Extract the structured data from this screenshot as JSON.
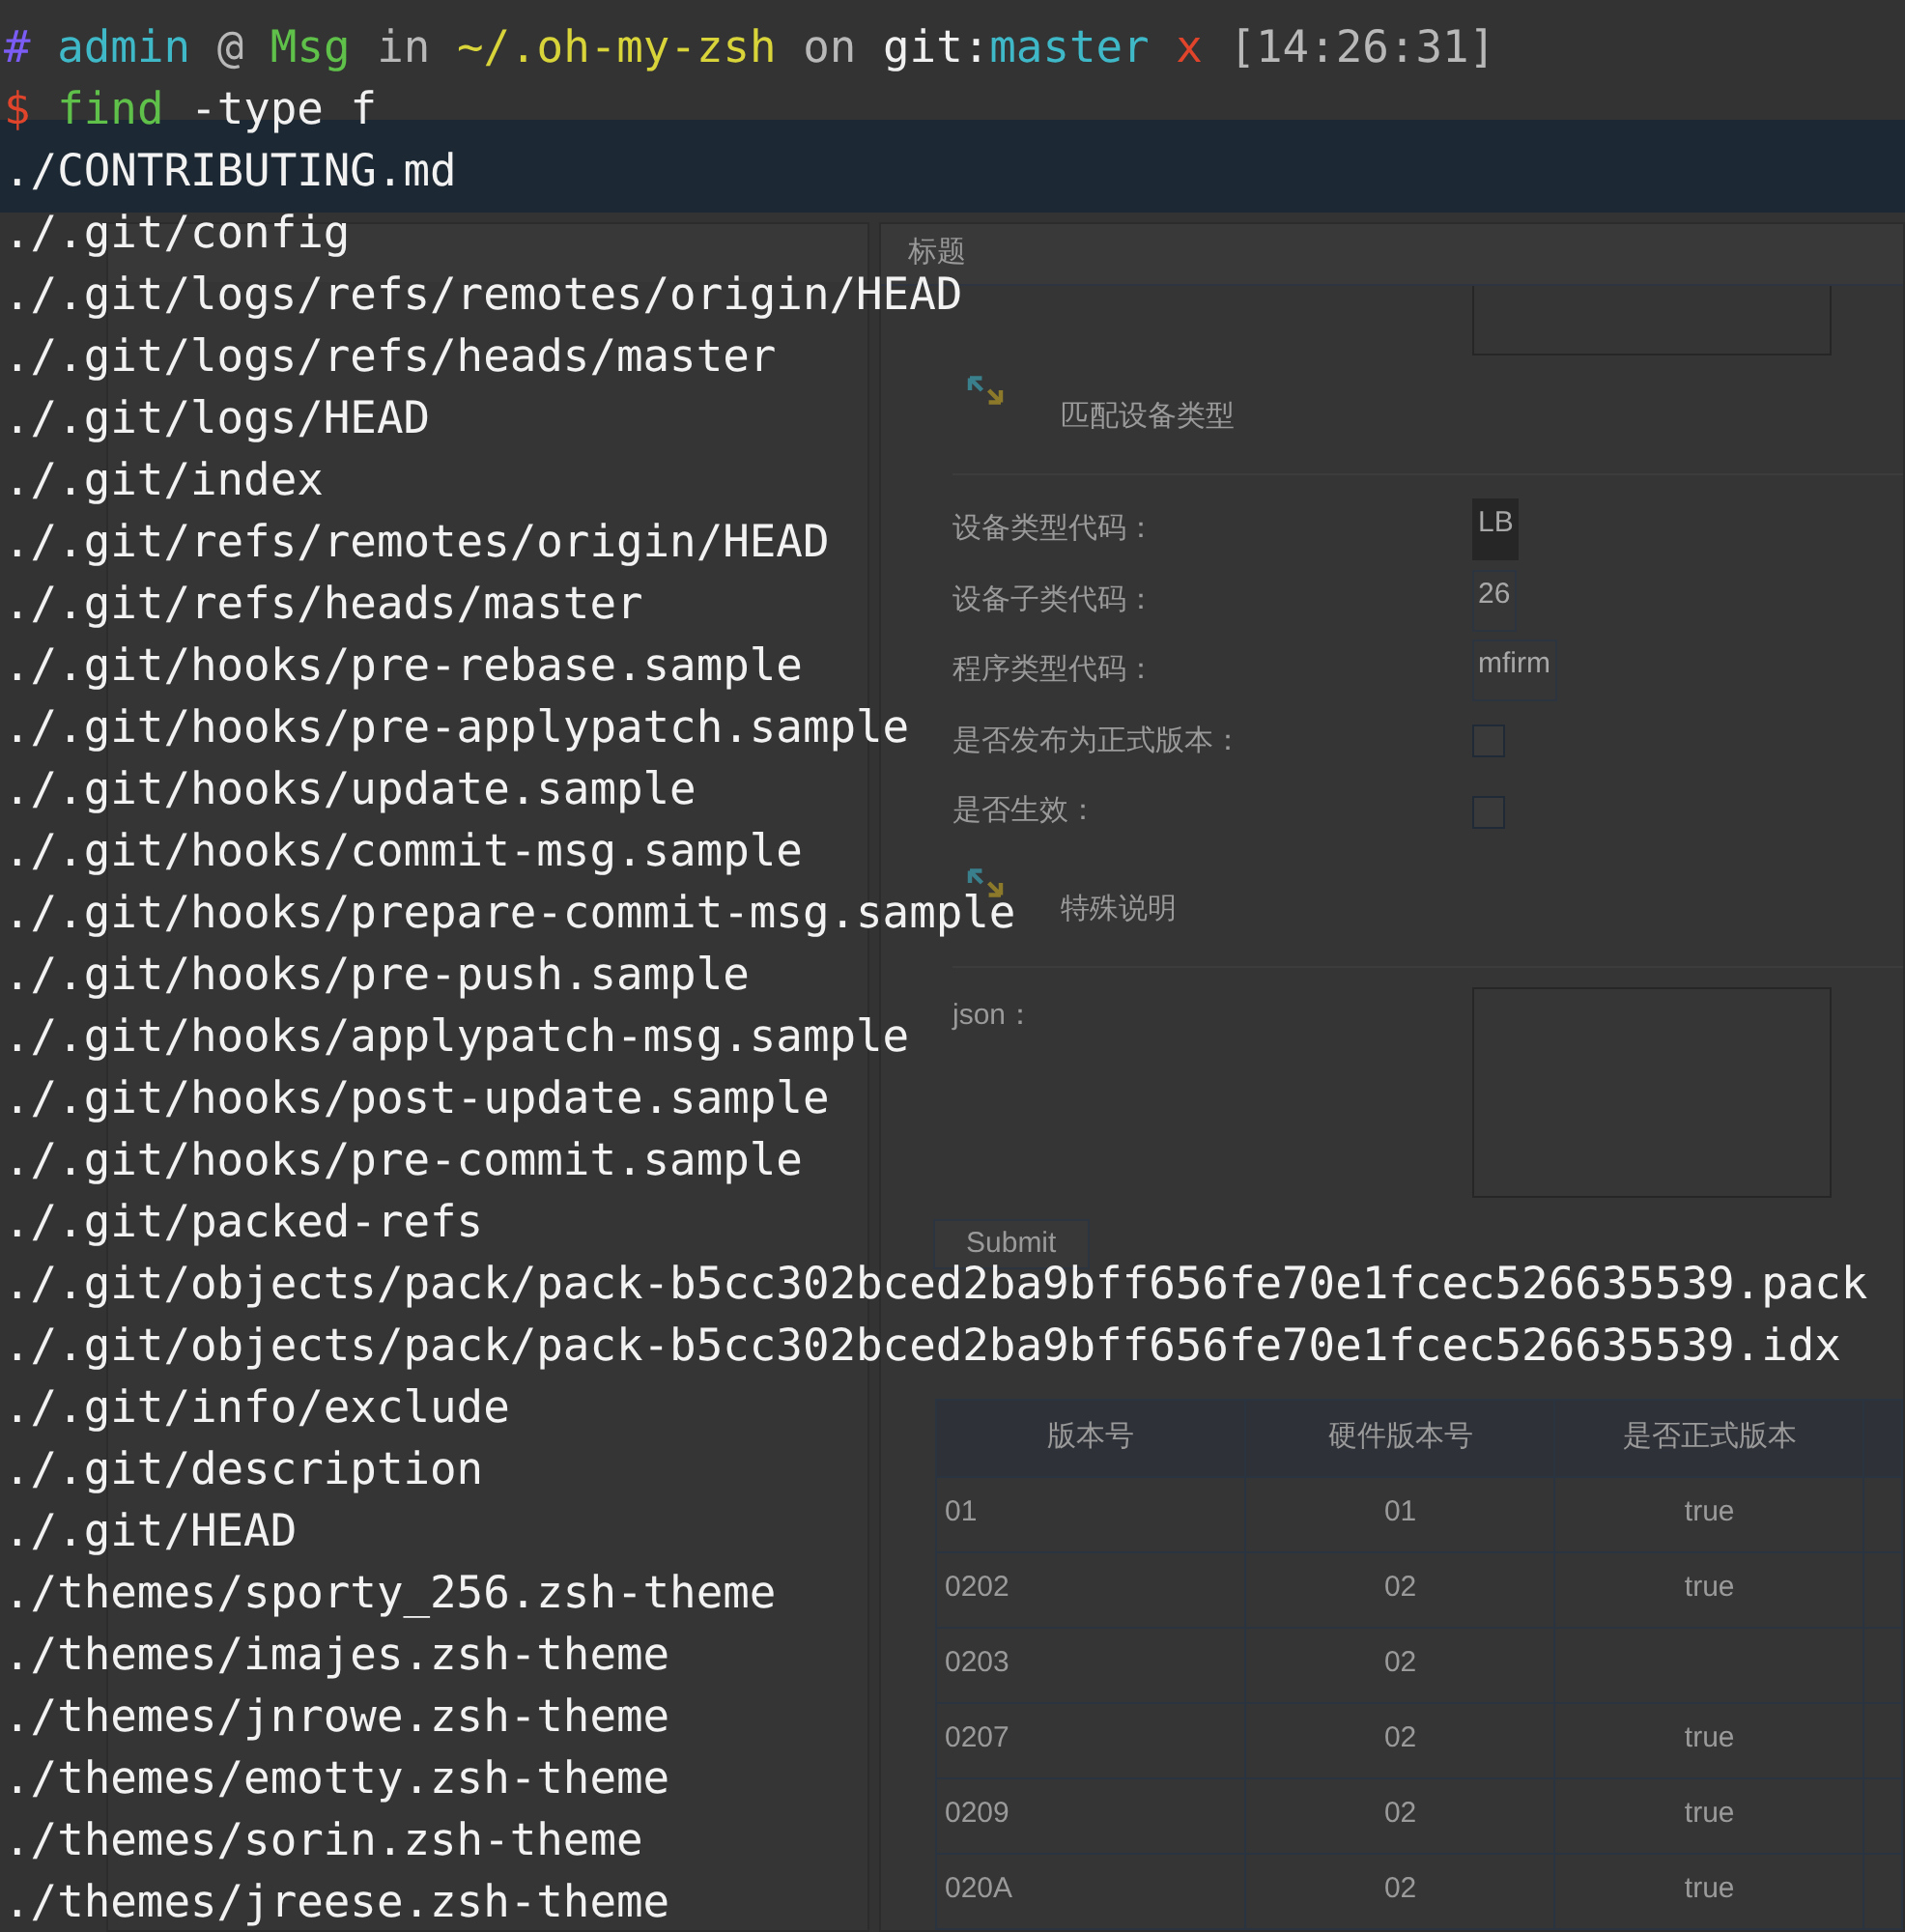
{
  "terminal": {
    "prompt": [
      {
        "text": "#",
        "color": "#7b5cf5"
      },
      {
        "text": "admin",
        "color": "#3fb8c8"
      },
      {
        "text": "@",
        "color": "#b8b8b8"
      },
      {
        "text": "Msg",
        "color": "#5fc04a"
      },
      {
        "text": "in",
        "color": "#b8b8b8"
      },
      {
        "text": "~/.oh-my-zsh",
        "color": "#d8d43a"
      },
      {
        "text": "on",
        "color": "#b8b8b8"
      },
      {
        "text": "git:",
        "color": "#f0f0f0"
      },
      {
        "text": "master",
        "color": "#3fb8c8",
        "join": true
      },
      {
        "text": "x",
        "color": "#e0452c"
      },
      {
        "text": "[14:26:31]",
        "color": "#b8b8b8"
      }
    ],
    "command": [
      {
        "text": "$",
        "color": "#e0452c"
      },
      {
        "text": "find",
        "color": "#5fc04a"
      },
      {
        "text": "-type f",
        "color": "#f0f0f0"
      }
    ],
    "output": [
      "./CONTRIBUTING.md",
      "./.git/config",
      "./.git/logs/refs/remotes/origin/HEAD",
      "./.git/logs/refs/heads/master",
      "./.git/logs/HEAD",
      "./.git/index",
      "./.git/refs/remotes/origin/HEAD",
      "./.git/refs/heads/master",
      "./.git/hooks/pre-rebase.sample",
      "./.git/hooks/pre-applypatch.sample",
      "./.git/hooks/update.sample",
      "./.git/hooks/commit-msg.sample",
      "./.git/hooks/prepare-commit-msg.sample",
      "./.git/hooks/pre-push.sample",
      "./.git/hooks/applypatch-msg.sample",
      "./.git/hooks/post-update.sample",
      "./.git/hooks/pre-commit.sample",
      "./.git/packed-refs",
      "./.git/objects/pack/pack-b5cc302bced2ba9bff656fe70e1fcec526635539.pack",
      "./.git/objects/pack/pack-b5cc302bced2ba9bff656fe70e1fcec526635539.idx",
      "./.git/info/exclude",
      "./.git/description",
      "./.git/HEAD",
      "./themes/sporty_256.zsh-theme",
      "./themes/imajes.zsh-theme",
      "./themes/jnrowe.zsh-theme",
      "./themes/emotty.zsh-theme",
      "./themes/sorin.zsh-theme",
      "./themes/jreese.zsh-theme"
    ]
  },
  "page": {
    "form": {
      "title": "标题",
      "sections": [
        {
          "title": "匹配设备类型",
          "fields": [
            {
              "kind": "text",
              "label": "设备类型代码：",
              "value": "LB",
              "disabled": true
            },
            {
              "kind": "text",
              "label": "设备子类代码：",
              "value": "26",
              "disabled": false
            },
            {
              "kind": "text",
              "label": "程序类型代码：",
              "value": "mfirm",
              "disabled": false
            },
            {
              "kind": "checkbox",
              "label": "是否发布为正式版本：",
              "checked": false
            },
            {
              "kind": "checkbox",
              "label": "是否生效：",
              "checked": false
            }
          ]
        },
        {
          "title": "特殊说明",
          "fields": [
            {
              "kind": "textarea",
              "label": "json："
            }
          ]
        }
      ],
      "submit": "Submit"
    },
    "table": {
      "columns": [
        "版本号",
        "硬件版本号",
        "是否正式版本"
      ],
      "rows": [
        [
          "01",
          "01",
          "true"
        ],
        [
          "0202",
          "02",
          "true"
        ],
        [
          "0203",
          "02",
          null
        ],
        [
          "0207",
          "02",
          "true"
        ],
        [
          "0209",
          "02",
          "true"
        ],
        [
          "020A",
          "02",
          "true"
        ]
      ]
    }
  }
}
